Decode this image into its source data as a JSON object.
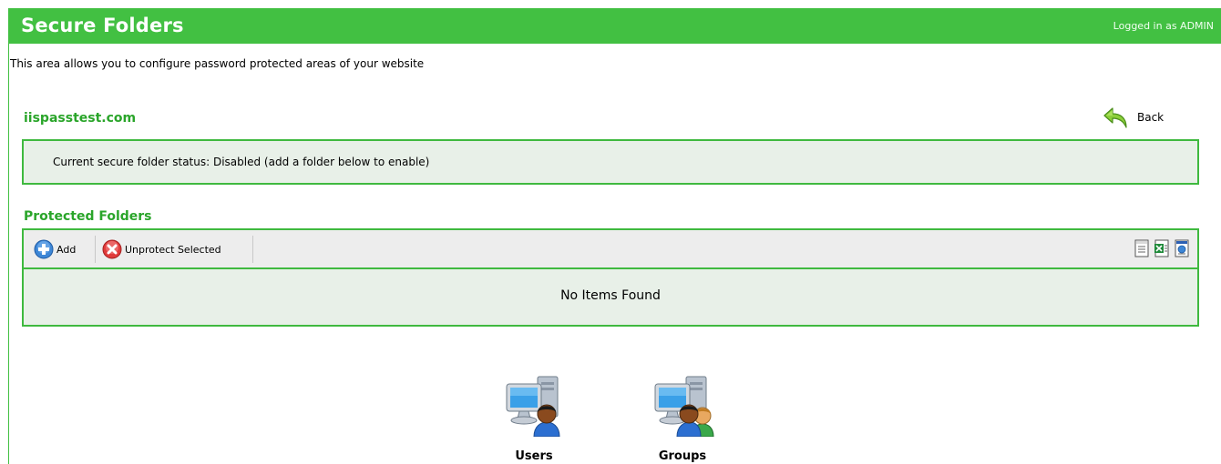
{
  "header": {
    "title": "Secure Folders",
    "login_text": "Logged in as ADMIN"
  },
  "description": "This area allows you to configure password protected areas of your website",
  "site_name": "iispasstest.com",
  "back_label": "Back",
  "status_text": "Current secure folder status: Disabled (add a folder below to enable)",
  "protected": {
    "title": "Protected Folders",
    "toolbar": {
      "add_label": "Add",
      "unprotect_label": "Unprotect Selected"
    },
    "empty_text": "No Items Found"
  },
  "tiles": {
    "users_label": "Users",
    "groups_label": "Groups"
  },
  "colors": {
    "brand_green": "#42c042",
    "panel_bg": "#e8f0e8",
    "link_green": "#2aa52a"
  }
}
